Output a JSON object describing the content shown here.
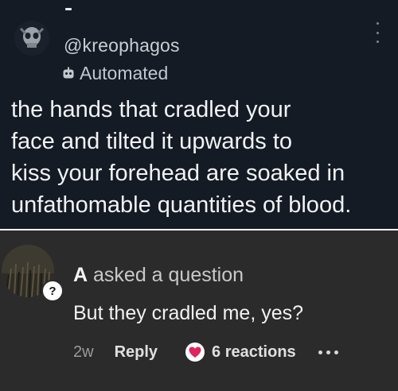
{
  "tweet": {
    "handle": "@kreophagos",
    "badge_label": "Automated",
    "badge_icon": "robot-icon",
    "text": "the hands that cradled your\nface and tilted it upwards to\nkiss your forehead are soaked in\nunfathomable quantities of blood.",
    "colors": {
      "background": "#151b24",
      "text": "#f1f3f5"
    }
  },
  "comment": {
    "author": "A",
    "action": "asked a question",
    "badge_glyph": "?",
    "text": "But they cradled me, yes?",
    "time": "2w",
    "reply_label": "Reply",
    "reactions_label": "6 reactions",
    "reaction_icon": "heart-icon",
    "colors": {
      "background": "#2b2b2b",
      "reaction": "#e0245e"
    }
  }
}
